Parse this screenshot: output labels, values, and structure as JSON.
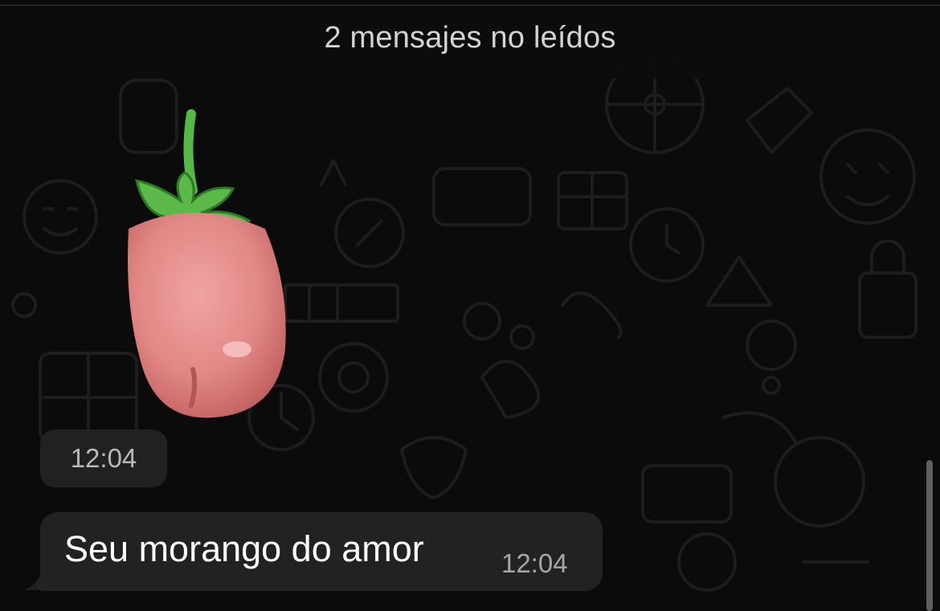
{
  "chat": {
    "unread_banner": "2 mensajes no leídos",
    "sticker": {
      "time": "12:04"
    },
    "message": {
      "text": "Seu morango do amor",
      "time": "12:04"
    }
  },
  "icons": [
    "doodle-background",
    "strawberry-tongue-sticker"
  ],
  "colors": {
    "background": "#0b0b0b",
    "banner": "#0c0c0c",
    "bubble": "#222222",
    "time_chip": "#212121",
    "text_primary": "#ffffff",
    "text_secondary": "#a6a6a6"
  }
}
